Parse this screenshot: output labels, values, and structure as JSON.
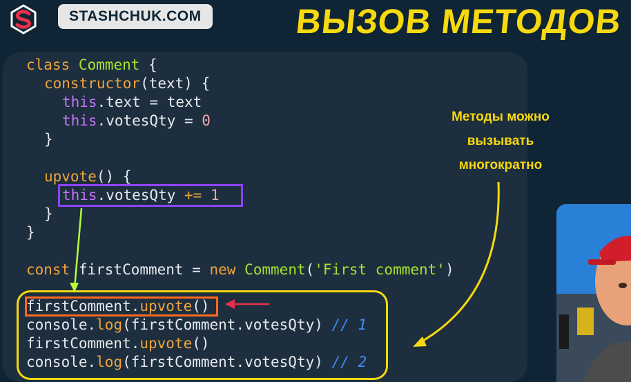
{
  "header": {
    "brand": "STASHCHUK.COM",
    "title": "ВЫЗОВ МЕТОДОВ"
  },
  "code": {
    "l1": {
      "kw": "class",
      "name": "Comment",
      "rest": " {"
    },
    "l2": {
      "fn": "constructor",
      "rest": "(text) {"
    },
    "l3": {
      "this": "this",
      "rest": ".text = text"
    },
    "l4": {
      "this": "this",
      "rest": ".votesQty = ",
      "num": "0"
    },
    "l5": {
      "rest": "}"
    },
    "l6": {
      "fn": "upvote",
      "rest": "() {"
    },
    "l7": {
      "this": "this",
      "rest": ".votesQty ",
      "op": "+=",
      "num": "1"
    },
    "l8": {
      "rest": "}"
    },
    "l9": {
      "rest": "}"
    },
    "l10": {
      "kw": "const",
      "a": " firstComment = ",
      "kw2": "new",
      "cls": "Comment",
      "p1": "(",
      "str": "'First comment'",
      "p2": ")"
    },
    "l11": {
      "a": "firstComment.",
      "fn": "upvote",
      "b": "()"
    },
    "l12": {
      "a": "console.",
      "fn": "log",
      "b": "(firstComment.votesQty) ",
      "cmt": "// 1"
    },
    "l13": {
      "a": "firstComment.",
      "fn": "upvote",
      "b": "()"
    },
    "l14": {
      "a": "console.",
      "fn": "log",
      "b": "(firstComment.votesQty) ",
      "cmt": "// 2"
    }
  },
  "annotation": {
    "line1": "Методы можно",
    "line2": "вызывать",
    "line3": "многократно"
  },
  "colors": {
    "background": "#0f2535",
    "panel": "#1d2f3e",
    "accent_yellow": "#f7d90f",
    "accent_purple": "#8e43ff",
    "accent_orange": "#ff6b1f",
    "accent_red": "#e8304a",
    "accent_green": "#b6ff3b"
  },
  "icons": {
    "logo": "stashchuk-s-logo-icon"
  }
}
